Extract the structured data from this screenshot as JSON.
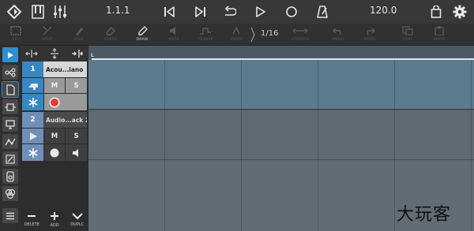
{
  "topbar": {
    "position": "1.1.1",
    "tempo": "120.0",
    "icons": [
      "app-logo-icon",
      "piano-keys-icon",
      "mixer-icon",
      "skip-back-icon",
      "skip-forward-icon",
      "loop-icon",
      "play-icon",
      "record-icon",
      "metronome-icon",
      "bag-icon",
      "settings-icon"
    ]
  },
  "toolbar": {
    "tools": [
      {
        "name": "sel",
        "label": "SEL",
        "icon": "select-icon"
      },
      {
        "name": "split",
        "label": "SPLIT",
        "icon": "split-icon"
      },
      {
        "name": "glue",
        "label": "GLUE",
        "icon": "glue-icon"
      },
      {
        "name": "erase",
        "label": "ERASE",
        "icon": "eraser-icon"
      },
      {
        "name": "draw",
        "label": "DRAW",
        "icon": "pencil-icon"
      },
      {
        "name": "mute",
        "label": "MUTE",
        "icon": "mute-icon"
      },
      {
        "name": "transp",
        "label": "TRANSP",
        "icon": "transpose-icon"
      },
      {
        "name": "quant",
        "label": "QUANT",
        "icon": "quantize-icon"
      },
      {
        "name": "stretch",
        "label": "STRETCH",
        "icon": "stretch-icon"
      },
      {
        "name": "undo",
        "label": "UNDO",
        "icon": "undo-icon"
      },
      {
        "name": "redo",
        "label": "REDO",
        "icon": "redo-icon"
      },
      {
        "name": "copy",
        "label": "COPY",
        "icon": "copy-icon"
      },
      {
        "name": "paste",
        "label": "PASTE",
        "icon": "paste-icon"
      }
    ],
    "active_tool": "DRAW",
    "quantize_value": "1/16"
  },
  "sidebar": {
    "items": [
      "play-view-icon",
      "routing-icon",
      "clip-icon",
      "plugin-icon",
      "screen-icon",
      "automation-icon",
      "edit-icon",
      "instrument-icon",
      "effects-icon",
      "menu-icon"
    ]
  },
  "tracks": [
    {
      "number": "1",
      "name": "Acou...iano",
      "mute": "M",
      "solo": "S"
    },
    {
      "number": "2",
      "name": "Audio...ack 2",
      "mute": "M",
      "solo": "S"
    }
  ],
  "bottom_buttons": [
    {
      "label": "DELETE",
      "icon": "minus-icon"
    },
    {
      "label": "ADD",
      "icon": "plus-icon"
    },
    {
      "label": "DUPLC",
      "icon": "chevron-down-icon"
    }
  ],
  "arrangement": {
    "loop_marker": "L"
  },
  "watermark": "大玩客",
  "colors": {
    "accent": "#2e8fd1",
    "track1": "#3687c4",
    "track2": "#6f8fb8",
    "record": "#e53935"
  }
}
